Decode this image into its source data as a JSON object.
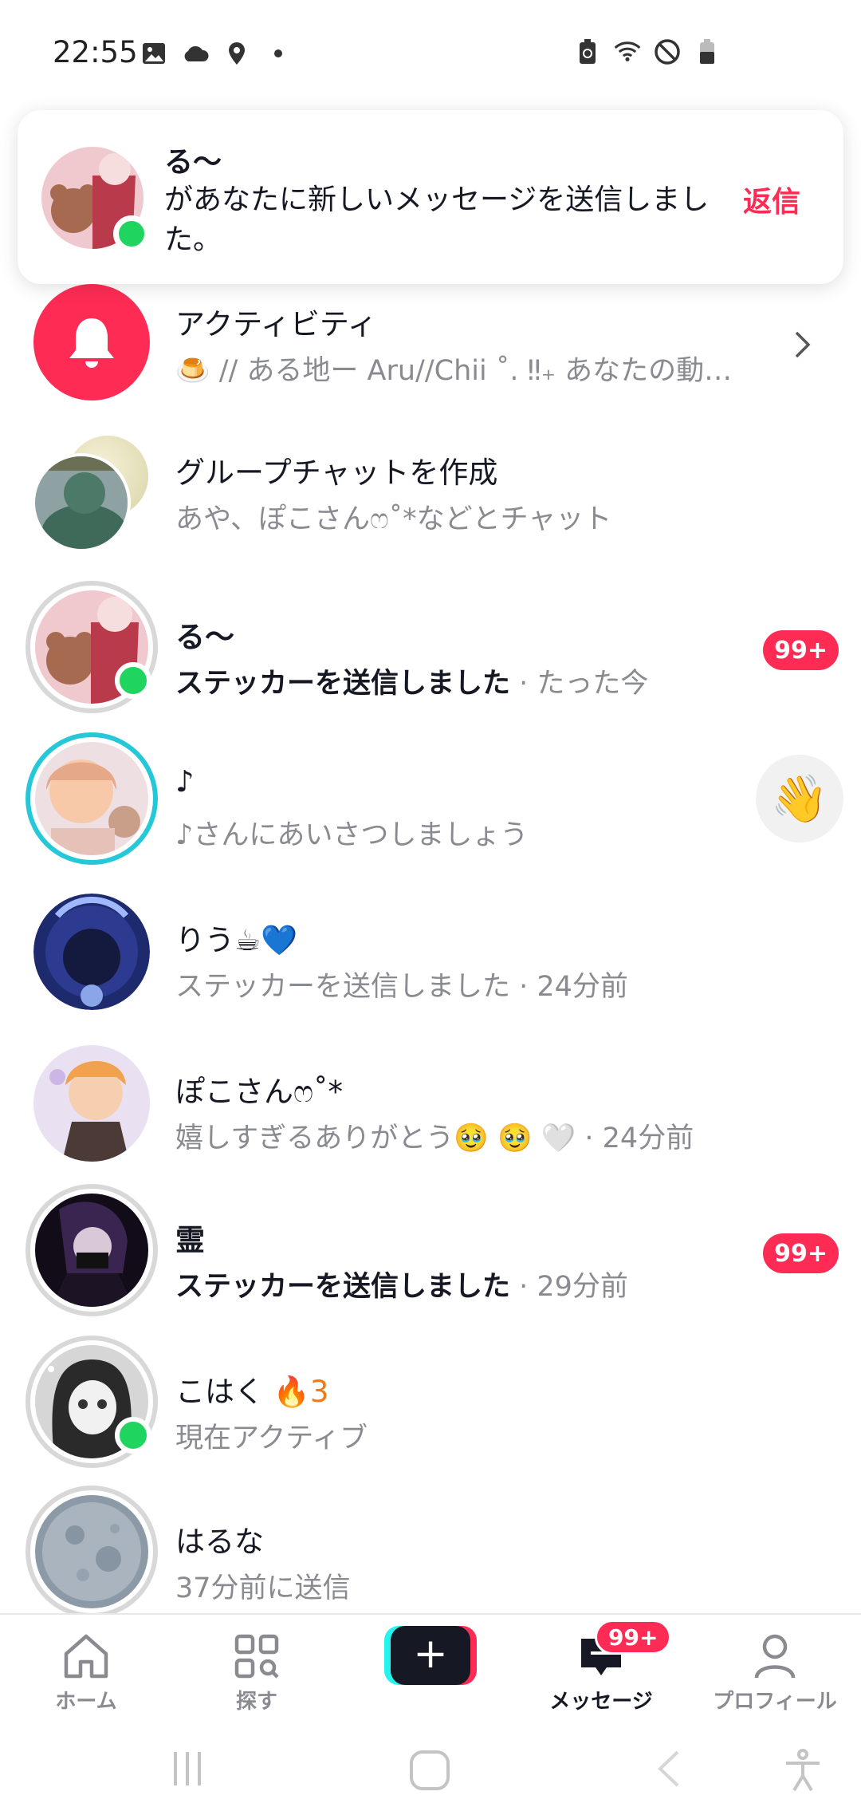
{
  "status": {
    "time": "22:55"
  },
  "banner": {
    "name": "る〜",
    "message": "があなたに新しいメッセージを送信しました。",
    "reply": "返信"
  },
  "activity": {
    "title": "アクティビティ",
    "subtitle": "🍮 // ある地ー Aru//Chii ˚. ‼︎₊ あなたの動…"
  },
  "group_chat": {
    "title": "グループチャットを作成",
    "subtitle": "あや、ぽこさんෆ˚*などとチャット"
  },
  "chats": [
    {
      "name": "る〜",
      "bold_text": "ステッカーを送信しました",
      "meta": " · たった今",
      "badge": "99+"
    },
    {
      "name": "♪",
      "text": "♪さんにあいさつしましょう",
      "wave": "👋"
    },
    {
      "name": "りう☕💙",
      "text": "ステッカーを送信しました · 24分前"
    },
    {
      "name": "ぽこさんෆ˚*",
      "text": "嬉しすぎるありがとう🥹 🥹 🤍 · 24分前"
    },
    {
      "name": "霊",
      "bold_text": "ステッカーを送信しました",
      "meta": " · 29分前",
      "badge": "99+"
    },
    {
      "name": "こはく",
      "streak_icon": "🔥",
      "streak": "3",
      "text": "現在アクティブ"
    },
    {
      "name": "はるな",
      "text": "37分前に送信"
    }
  ],
  "nav": {
    "home": "ホーム",
    "explore": "探す",
    "create": "+",
    "messages": "メッセージ",
    "messages_badge": "99+",
    "profile": "プロフィール"
  },
  "colors": {
    "accent": "#fe2c55",
    "online": "#20d55f",
    "story_ring": "#25c8d8"
  }
}
